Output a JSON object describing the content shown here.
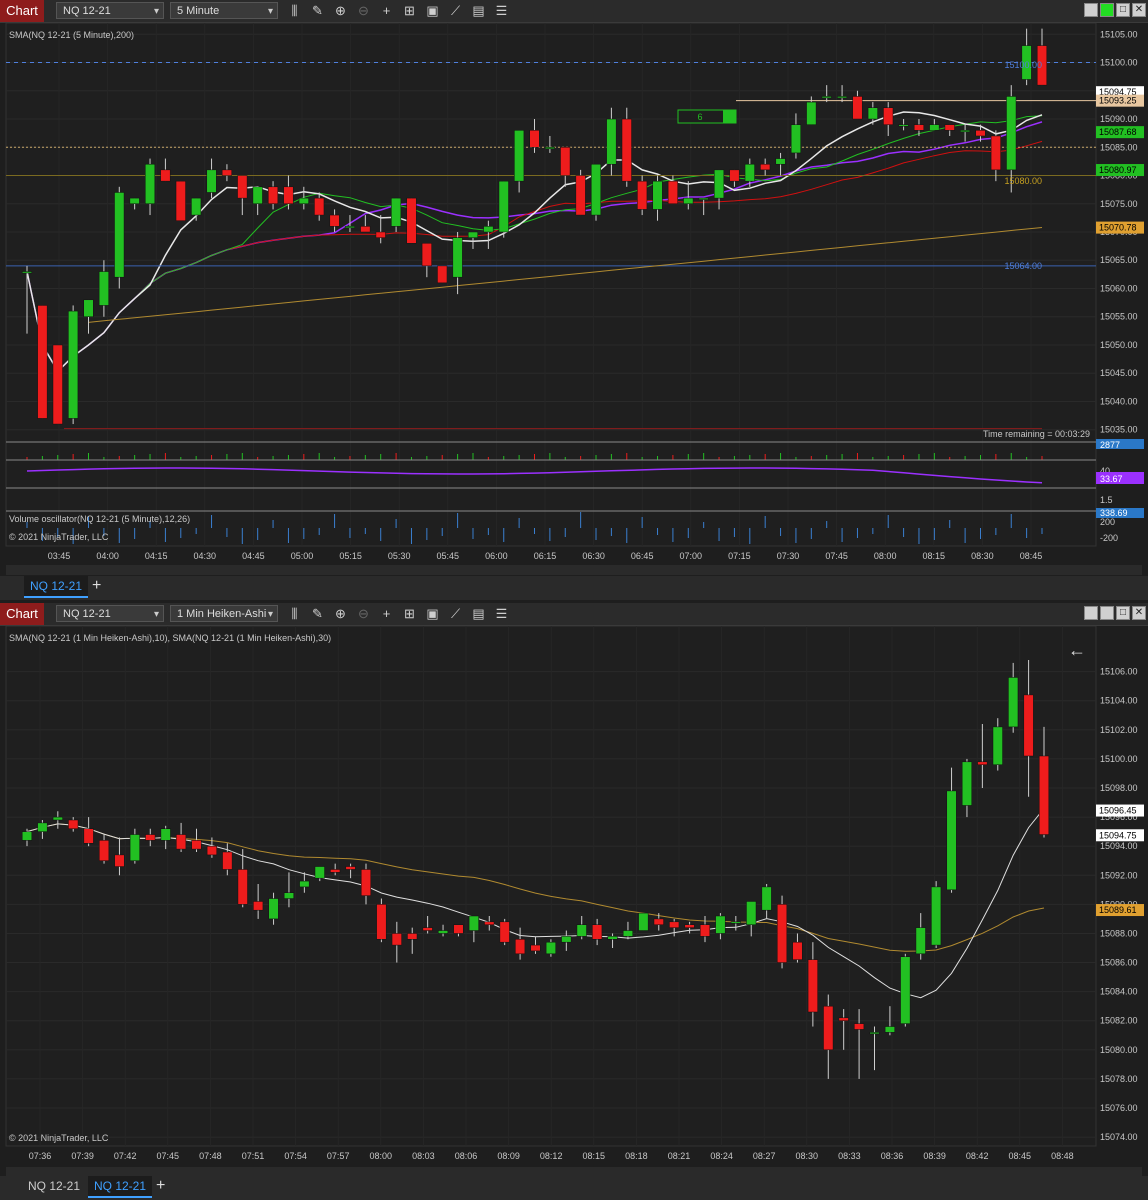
{
  "top": {
    "chart_label": "Chart",
    "instrument": "NQ 12-21",
    "interval": "5 Minute",
    "indicator_label": "SMA(NQ 12-21 (5 Minute),200)",
    "volume_osc_label": "Volume oscillator(NQ 12-21 (5 Minute),12,26)",
    "copyright": "© 2021 NinjaTrader, LLC",
    "time_remaining": "Time remaining = 00:03:29",
    "order_qty": "6",
    "line_labels": {
      "upper": "15100.00",
      "middle": "15080.00",
      "lower": "15064.00"
    },
    "price_ticks": [
      "15105.00",
      "15100.00",
      "15095.00",
      "15090.00",
      "15085.00",
      "15080.00",
      "15075.00",
      "15070.00",
      "15065.00",
      "15060.00",
      "15055.00",
      "15050.00",
      "15045.00",
      "15040.00",
      "15035.00"
    ],
    "price_badges": [
      {
        "text": "15094.75",
        "bg": "#ffffff",
        "fg": "#000000"
      },
      {
        "text": "15093.25",
        "bg": "#e8c7a0",
        "fg": "#000000"
      },
      {
        "text": "15087.68",
        "bg": "#22c022",
        "fg": "#000000"
      },
      {
        "text": "15080.97",
        "bg": "#22c022",
        "fg": "#000000"
      },
      {
        "text": "15070.78",
        "bg": "#e0a030",
        "fg": "#000000"
      }
    ],
    "volume_badge": "2877",
    "osc_ticks": [
      "40"
    ],
    "osc_badge": "33.67",
    "vo_ticks": [
      "1.5",
      "200",
      "-200"
    ],
    "vo_badge": "338.69",
    "time_ticks": [
      "03:45",
      "04:00",
      "04:15",
      "04:30",
      "04:45",
      "05:00",
      "05:15",
      "05:30",
      "05:45",
      "06:00",
      "06:15",
      "06:30",
      "06:45",
      "07:00",
      "07:15",
      "07:30",
      "07:45",
      "08:00",
      "08:15",
      "08:30",
      "08:45"
    ],
    "tab": "NQ 12-21"
  },
  "bottom": {
    "chart_label": "Chart",
    "instrument": "NQ 12-21",
    "interval": "1 Min Heiken-Ashi",
    "indicator_label": "SMA(NQ 12-21 (1 Min Heiken-Ashi),10), SMA(NQ 12-21 (1 Min Heiken-Ashi),30)",
    "copyright": "© 2021 NinjaTrader, LLC",
    "price_ticks": [
      "15106.00",
      "15104.00",
      "15102.00",
      "15100.00",
      "15098.00",
      "15096.00",
      "15094.00",
      "15092.00",
      "15090.00",
      "15088.00",
      "15086.00",
      "15084.00",
      "15082.00",
      "15080.00",
      "15078.00",
      "15076.00",
      "15074.00"
    ],
    "price_badges": [
      {
        "text": "15096.45",
        "bg": "#ffffff",
        "fg": "#000000"
      },
      {
        "text": "15094.75",
        "bg": "#ffffff",
        "fg": "#000000"
      },
      {
        "text": "15089.61",
        "bg": "#e0a030",
        "fg": "#000000"
      }
    ],
    "time_ticks": [
      "07:36",
      "07:39",
      "07:42",
      "07:45",
      "07:48",
      "07:51",
      "07:54",
      "07:57",
      "08:00",
      "08:03",
      "08:06",
      "08:09",
      "08:12",
      "08:15",
      "08:18",
      "08:21",
      "08:24",
      "08:27",
      "08:30",
      "08:33",
      "08:36",
      "08:39",
      "08:42",
      "08:45",
      "08:48"
    ],
    "tabs": [
      "NQ 12-21",
      "NQ 12-21"
    ]
  },
  "chart_data": [
    {
      "type": "candlestick",
      "title": "NQ 12-21 5 Minute",
      "up_color": "#22c022",
      "down_color": "#ee1c1c",
      "ohlc": [
        [
          15063,
          15064,
          15052,
          15063
        ],
        [
          15057,
          15057,
          15037,
          15037
        ],
        [
          15050,
          15050,
          15036,
          15036
        ],
        [
          15037,
          15057,
          15036,
          15056
        ],
        [
          15055,
          15058,
          15052,
          15058
        ],
        [
          15057,
          15065,
          15055,
          15063
        ],
        [
          15062,
          15078,
          15060,
          15077
        ],
        [
          15075,
          15076,
          15074,
          15076
        ],
        [
          15075,
          15083,
          15073,
          15082
        ],
        [
          15081,
          15083,
          15079,
          15079
        ],
        [
          15079,
          15079,
          15072,
          15072
        ],
        [
          15073,
          15076,
          15072,
          15076
        ],
        [
          15077,
          15083,
          15076,
          15081
        ],
        [
          15081,
          15082,
          15079,
          15080
        ],
        [
          15080,
          15080,
          15073,
          15076
        ],
        [
          15075,
          15078,
          15073,
          15078
        ],
        [
          15078,
          15079,
          15074,
          15075
        ],
        [
          15078,
          15080,
          15074,
          15075
        ],
        [
          15075,
          15078,
          15074,
          15076
        ],
        [
          15076,
          15077,
          15072,
          15073
        ],
        [
          15073,
          15074,
          15070,
          15071
        ],
        [
          15071,
          15073,
          15070,
          15071
        ],
        [
          15071,
          15073,
          15070,
          15070
        ],
        [
          15070,
          15073,
          15068,
          15069
        ],
        [
          15071,
          15076,
          15070,
          15076
        ],
        [
          15076,
          15076,
          15068,
          15068
        ],
        [
          15068,
          15068,
          15062,
          15064
        ],
        [
          15064,
          15064,
          15061,
          15061
        ],
        [
          15062,
          15070,
          15059,
          15069
        ],
        [
          15069,
          15070,
          15067,
          15070
        ],
        [
          15070,
          15072,
          15067,
          15071
        ],
        [
          15070,
          15079,
          15069,
          15079
        ],
        [
          15079,
          15088,
          15077,
          15088
        ],
        [
          15088,
          15090,
          15084,
          15085
        ],
        [
          15085,
          15087,
          15084,
          15085
        ],
        [
          15085,
          15085,
          15078,
          15080
        ],
        [
          15080,
          15081,
          15073,
          15073
        ],
        [
          15073,
          15082,
          15072,
          15082
        ],
        [
          15082,
          15092,
          15080,
          15090
        ],
        [
          15090,
          15092,
          15078,
          15079
        ],
        [
          15079,
          15080,
          15073,
          15074
        ],
        [
          15074,
          15080,
          15072,
          15079
        ],
        [
          15079,
          15080,
          15075,
          15075
        ],
        [
          15075,
          15079,
          15074,
          15076
        ],
        [
          15076,
          15076,
          15073,
          15076
        ],
        [
          15076,
          15081,
          15074,
          15081
        ],
        [
          15081,
          15081,
          15078,
          15079
        ],
        [
          15079,
          15083,
          15078,
          15082
        ],
        [
          15082,
          15083,
          15080,
          15081
        ],
        [
          15082,
          15084,
          15080,
          15083
        ],
        [
          15084,
          15091,
          15083,
          15089
        ],
        [
          15089,
          15094,
          15089,
          15093
        ],
        [
          15094,
          15096,
          15093,
          15094
        ],
        [
          15094,
          15096,
          15093,
          15094
        ],
        [
          15094,
          15095,
          15090,
          15090
        ],
        [
          15090,
          15093,
          15089,
          15092
        ],
        [
          15092,
          15093,
          15087,
          15089
        ],
        [
          15089,
          15090,
          15088,
          15089
        ],
        [
          15089,
          15090,
          15087,
          15088
        ],
        [
          15088,
          15090,
          15088,
          15089
        ],
        [
          15089,
          15089,
          15087,
          15088
        ],
        [
          15088,
          15089,
          15086,
          15088
        ],
        [
          15088,
          15089,
          15086,
          15087
        ],
        [
          15087,
          15088,
          15079,
          15081
        ],
        [
          15081,
          15096,
          15077,
          15094
        ],
        [
          15097,
          15106,
          15096,
          15103
        ],
        [
          15103,
          15106,
          15096,
          15096
        ]
      ],
      "ylim": [
        15033,
        15107
      ]
    },
    {
      "type": "candlestick",
      "title": "NQ 12-21 1 Min Heiken-Ashi",
      "up_color": "#22c022",
      "down_color": "#ee1c1c",
      "ohlc": [
        [
          15094.4,
          15095.2,
          15094,
          15095.0
        ],
        [
          15095.0,
          15095.8,
          15094.5,
          15095.6
        ],
        [
          15095.8,
          15096.4,
          15095.2,
          15096.0
        ],
        [
          15095.8,
          15096.0,
          15095,
          15095.2
        ],
        [
          15095.2,
          15096.0,
          15094,
          15094.2
        ],
        [
          15094.4,
          15094.8,
          15092.8,
          15093.0
        ],
        [
          15093.4,
          15094.6,
          15092,
          15092.6
        ],
        [
          15093.0,
          15095.2,
          15092.8,
          15094.8
        ],
        [
          15094.8,
          15095.2,
          15094,
          15094.4
        ],
        [
          15094.4,
          15095.4,
          15093.8,
          15095.2
        ],
        [
          15094.8,
          15095.6,
          15093.6,
          15093.8
        ],
        [
          15094.4,
          15095.2,
          15093.6,
          15093.8
        ],
        [
          15094.0,
          15094.6,
          15093.2,
          15093.4
        ],
        [
          15093.6,
          15094.2,
          15092,
          15092.4
        ],
        [
          15092.4,
          15093.8,
          15089.8,
          15090.0
        ],
        [
          15090.2,
          15091.4,
          15089,
          15089.6
        ],
        [
          15089.0,
          15090.8,
          15088.6,
          15090.4
        ],
        [
          15090.4,
          15092.2,
          15089.8,
          15090.8
        ],
        [
          15091.2,
          15092.2,
          15090.8,
          15091.6
        ],
        [
          15091.8,
          15092.6,
          15091.6,
          15092.6
        ],
        [
          15092.4,
          15092.8,
          15092,
          15092.2
        ],
        [
          15092.6,
          15092.8,
          15091.8,
          15092.4
        ],
        [
          15092.4,
          15092.8,
          15090,
          15090.6
        ],
        [
          15090.0,
          15090.4,
          15087.4,
          15087.6
        ],
        [
          15088.0,
          15088.8,
          15086,
          15087.2
        ],
        [
          15088.0,
          15088.4,
          15086.6,
          15087.6
        ],
        [
          15088.4,
          15089.2,
          15088,
          15088.2
        ],
        [
          15088.0,
          15088.6,
          15087.8,
          15088.2
        ],
        [
          15088.6,
          15088.6,
          15087.8,
          15088.0
        ],
        [
          15088.2,
          15089.2,
          15087.4,
          15089.2
        ],
        [
          15088.8,
          15089.2,
          15088.2,
          15088.6
        ],
        [
          15088.8,
          15089.0,
          15087.2,
          15087.4
        ],
        [
          15087.6,
          15088.4,
          15086.2,
          15086.6
        ],
        [
          15087.2,
          15087.8,
          15086.6,
          15086.8
        ],
        [
          15086.6,
          15087.6,
          15086.4,
          15087.4
        ],
        [
          15087.4,
          15088.2,
          15086.8,
          15087.8
        ],
        [
          15087.8,
          15089.2,
          15087.6,
          15088.6
        ],
        [
          15088.6,
          15089.0,
          15087.2,
          15087.6
        ],
        [
          15087.6,
          15088.0,
          15087,
          15087.8
        ],
        [
          15087.8,
          15088.8,
          15087.6,
          15088.2
        ],
        [
          15088.2,
          15089.4,
          15088.2,
          15089.4
        ],
        [
          15089.0,
          15089.4,
          15088.2,
          15088.6
        ],
        [
          15088.8,
          15089.0,
          15087.8,
          15088.4
        ],
        [
          15088.6,
          15088.8,
          15088,
          15088.4
        ],
        [
          15088.6,
          15089.2,
          15087.4,
          15087.8
        ],
        [
          15088.0,
          15089.4,
          15087.6,
          15089.2
        ],
        [
          15088.8,
          15089.2,
          15088.2,
          15088.8
        ],
        [
          15088.6,
          15089.8,
          15087.8,
          15090.2
        ],
        [
          15089.6,
          15091.4,
          15089,
          15091.2
        ],
        [
          15090.0,
          15090.6,
          15085.6,
          15086.0
        ],
        [
          15087.4,
          15088.0,
          15086,
          15086.2
        ],
        [
          15086.2,
          15087.4,
          15081.6,
          15082.6
        ],
        [
          15083.0,
          15083.8,
          15078,
          15080.0
        ],
        [
          15082.2,
          15082.8,
          15080,
          15082.0
        ],
        [
          15081.8,
          15082.8,
          15078,
          15081.4
        ],
        [
          15081.2,
          15081.6,
          15078.6,
          15081.2
        ],
        [
          15081.2,
          15083.0,
          15081,
          15081.6
        ],
        [
          15081.8,
          15086.6,
          15081.6,
          15086.4
        ],
        [
          15086.6,
          15089.4,
          15086.2,
          15088.4
        ],
        [
          15087.2,
          15091.6,
          15087,
          15091.2
        ],
        [
          15091.0,
          15099.4,
          15090.8,
          15097.8
        ],
        [
          15096.8,
          15100.0,
          15096,
          15099.8
        ],
        [
          15099.8,
          15102.4,
          15098,
          15099.6
        ],
        [
          15099.6,
          15102.8,
          15099.2,
          15102.2
        ],
        [
          15102.2,
          15106.6,
          15101.8,
          15105.6
        ],
        [
          15104.4,
          15106.8,
          15097.4,
          15100.2
        ],
        [
          15100.2,
          15102.2,
          15094.6,
          15094.8
        ]
      ],
      "ylim": [
        15073.8,
        15106.8
      ]
    }
  ]
}
